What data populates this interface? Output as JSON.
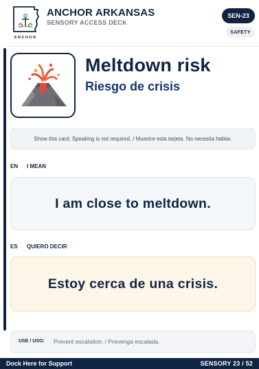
{
  "header": {
    "logo_text": "ANCHOR",
    "org_name": "ANCHOR ARKANSAS",
    "deck_name": "SENSORY ACCESS DECK",
    "card_code": "SEN-23",
    "category": "SAFETY"
  },
  "card": {
    "icon": "volcano-icon",
    "title_en": "Meltdown risk",
    "title_es": "Riesgo de crisis",
    "instruction": "Show this card. Speaking is not required. / Muestre esta tarjeta. No necesita hablar.",
    "en_code": "EN",
    "en_label": "I MEAN",
    "en_phrase": "I am close to meltdown.",
    "es_code": "ES",
    "es_label": "QUIERO DECIR",
    "es_phrase": "Estoy cerca de una crisis.",
    "use_label": "USE / USO:",
    "use_text": "Prevent escalation. / Prevenga escalada."
  },
  "footer": {
    "left": "Dock Here for Support",
    "right": "SENSORY 23 / 52"
  },
  "colors": {
    "navy": "#0f2442",
    "en_box": "#f3f7fa",
    "es_box": "#fdf6e9"
  }
}
